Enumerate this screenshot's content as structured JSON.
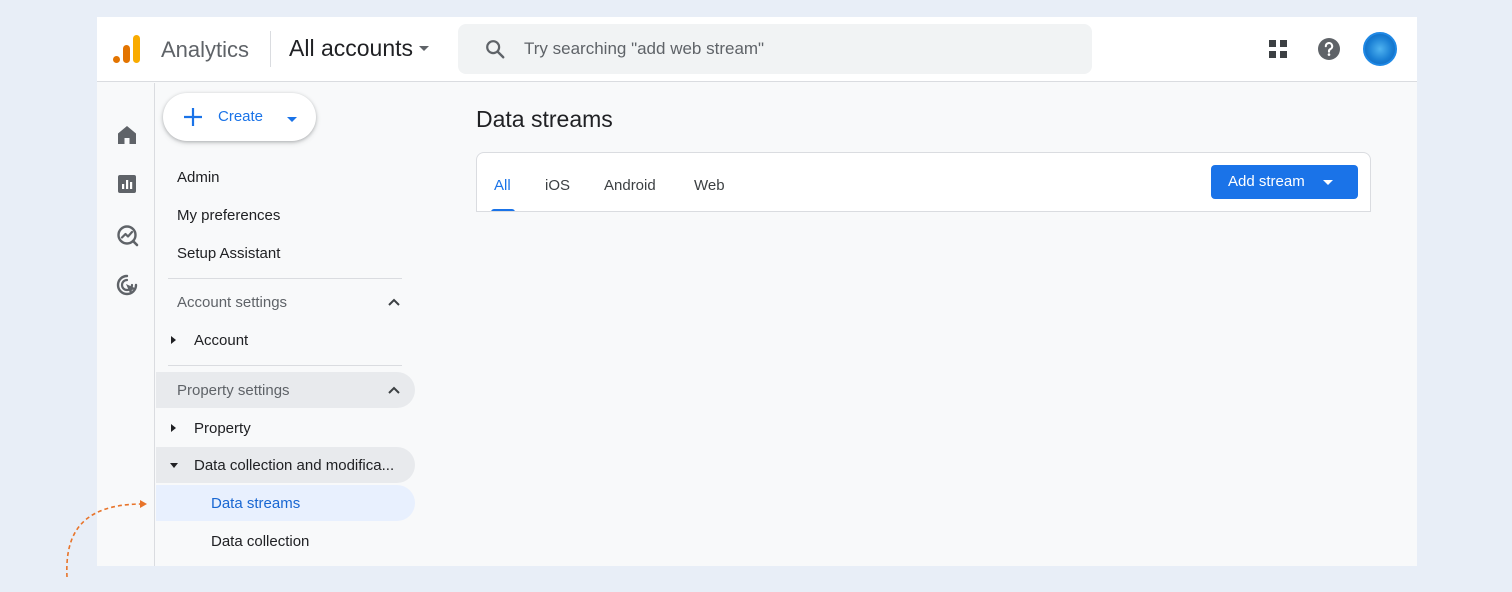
{
  "header": {
    "app_name": "Analytics",
    "account_picker": "All accounts",
    "search_placeholder": "Try searching \"add web stream\""
  },
  "create": {
    "label": "Create"
  },
  "nav": {
    "admin": "Admin",
    "preferences": "My preferences",
    "setup": "Setup Assistant",
    "account_settings": "Account settings",
    "account": "Account",
    "property_settings": "Property settings",
    "property": "Property",
    "data_collection_mod": "Data collection and modifica...",
    "data_streams": "Data streams",
    "data_collection": "Data collection"
  },
  "main": {
    "title": "Data streams",
    "tabs": [
      "All",
      "iOS",
      "Android",
      "Web"
    ],
    "active_tab": "All",
    "add_stream": "Add stream"
  },
  "colors": {
    "accent": "#1a73e8",
    "logo_orange": "#f9ab00",
    "logo_dark": "#e37400",
    "annotation": "#e8742a"
  }
}
